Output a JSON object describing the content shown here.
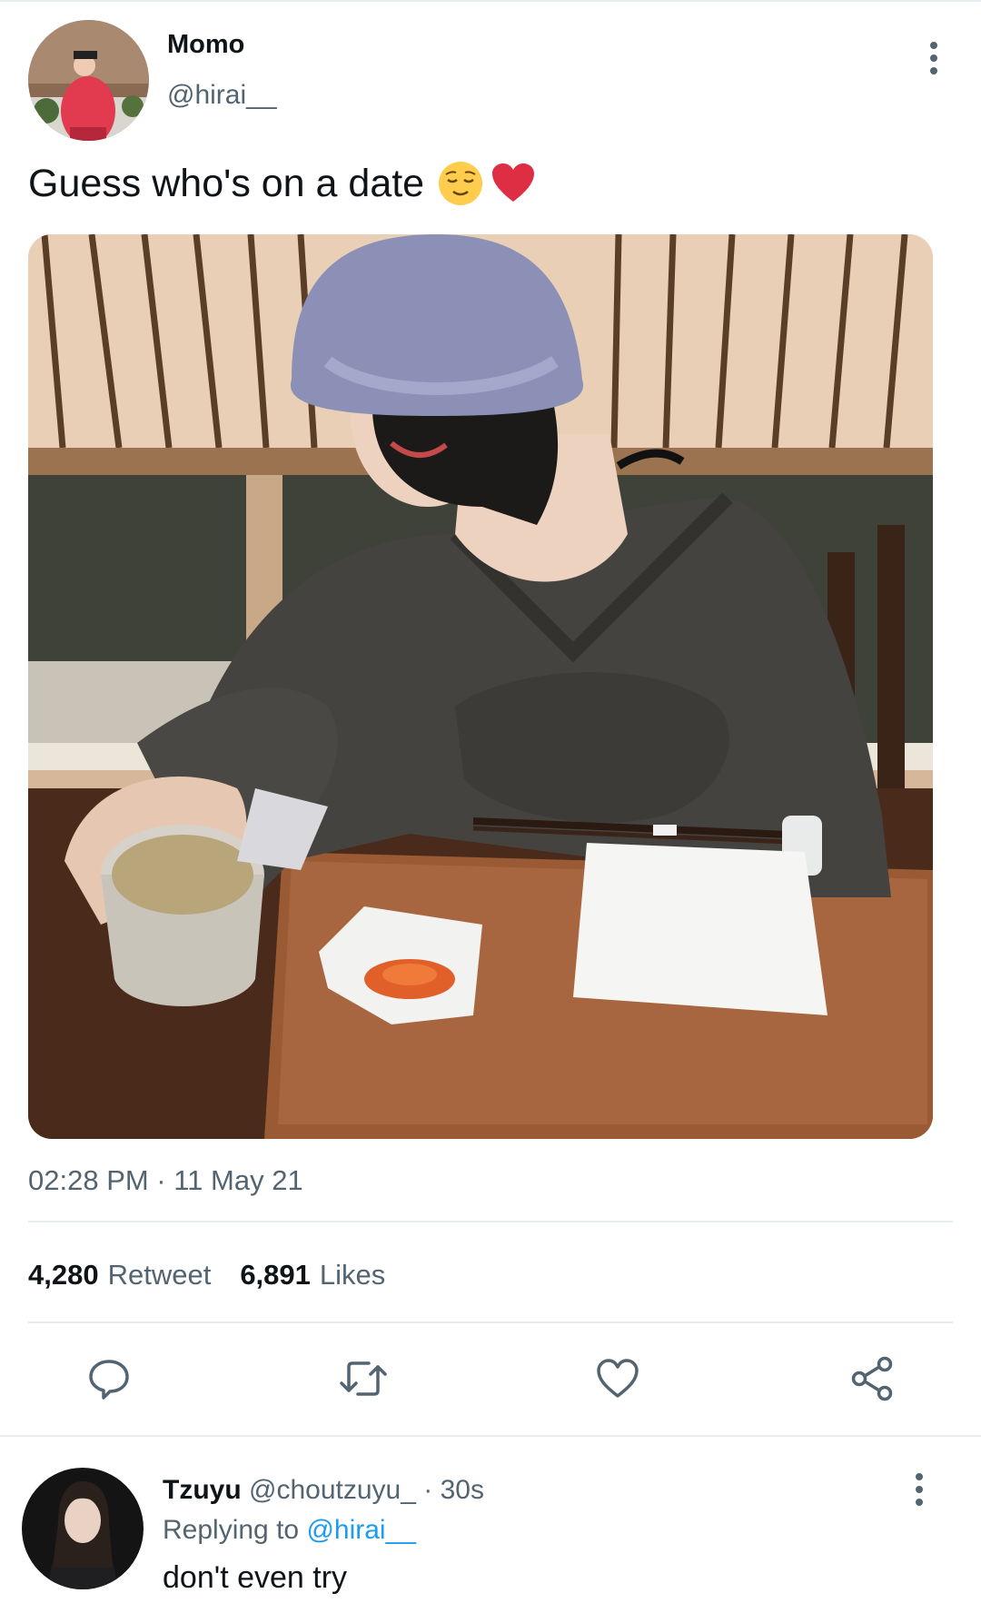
{
  "tweet": {
    "author": {
      "display_name": "Momo",
      "handle": "@hirai__"
    },
    "text": "Guess who's on a date",
    "emojis": [
      "relieved-face",
      "red-heart"
    ],
    "timestamp": "02:28 PM · 11 May 21",
    "stats": {
      "retweets_count": "4,280",
      "retweets_label": "Retweet",
      "likes_count": "6,891",
      "likes_label": "Likes"
    },
    "actions": [
      "reply-icon",
      "retweet-icon",
      "like-icon",
      "share-icon"
    ],
    "more_icon": "more-vertical-icon"
  },
  "reply": {
    "display_name": "Tzuyu",
    "handle": "@choutzuyu_",
    "separator": "·",
    "time": "30s",
    "replying_prefix": "Replying to",
    "replying_to": "@hirai__",
    "text": "don't even try"
  },
  "colors": {
    "text_primary": "#0f1419",
    "text_secondary": "#536471",
    "link": "#1d9bf0",
    "divider": "#e6ecf0"
  }
}
